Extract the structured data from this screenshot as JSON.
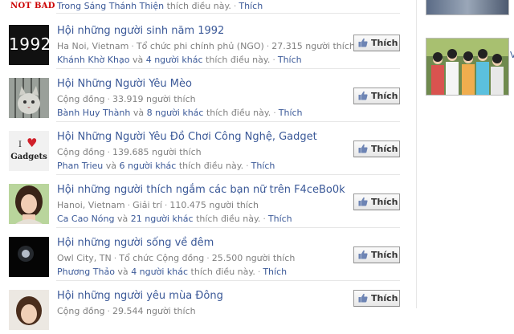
{
  "top_row": {
    "badge": "NOT BAD",
    "name": "Trong Sáng Thánh Thiện",
    "text": "thích điều này.",
    "like": "Thích"
  },
  "pages": [
    {
      "title": "Hội những người sinh năm 1992",
      "thumb_text": "1992",
      "meta": [
        "Ha Noi, Vietnam",
        "Tổ chức phi chính phủ (NGO)",
        "27.315 người thích"
      ],
      "friend": "Khánh Khờ Khạo",
      "connector": "và",
      "others": "4 người khác",
      "suffix": "thích điều này.",
      "like_link": "Thích",
      "button": "Thích"
    },
    {
      "title": "Hội Những Người Yêu Mèo",
      "meta": [
        "Cộng đồng",
        "33.919 người thích"
      ],
      "friend": "Bành Huy Thành",
      "connector": "và",
      "others": "8 người khác",
      "suffix": "thích điều này.",
      "like_link": "Thích",
      "button": "Thích"
    },
    {
      "title": "Hội Những Người Yêu Đồ Chơi Công Nghệ, Gadget",
      "thumb_text_1": "I",
      "thumb_text_2": "Gadgets",
      "meta": [
        "Cộng đồng",
        "139.685 người thích"
      ],
      "friend": "Phan Trieu",
      "connector": "và",
      "others": "6 người khác",
      "suffix": "thích điều này.",
      "like_link": "Thích",
      "button": "Thích"
    },
    {
      "title": "Hội những người thích ngắm các bạn nữ trên F4ceBo0k",
      "meta": [
        "Hanoi, Vietnam",
        "Giải trí",
        "110.475 người thích"
      ],
      "friend": "Ca Cao Nóng",
      "connector": "và",
      "others": "21 người khác",
      "suffix": "thích điều này.",
      "like_link": "Thích",
      "button": "Thích"
    },
    {
      "title": "Hội những người sống về đêm",
      "meta": [
        "Owl City, TN",
        "Tổ chức Cộng đồng",
        "25.500 người thích"
      ],
      "friend": "Phương Thảo",
      "connector": "và",
      "others": "4 người khác",
      "suffix": "thích điều này.",
      "like_link": "Thích",
      "button": "Thích"
    },
    {
      "title": "Hội những người yêu mùa Đông",
      "meta": [
        "Cộng đồng",
        "29.544 người thích"
      ],
      "button": "Thích"
    }
  ],
  "sidebar": {
    "text": "V"
  },
  "colors": {
    "link": "#3b5998",
    "meta": "#808080",
    "badge": "#cc0000"
  }
}
